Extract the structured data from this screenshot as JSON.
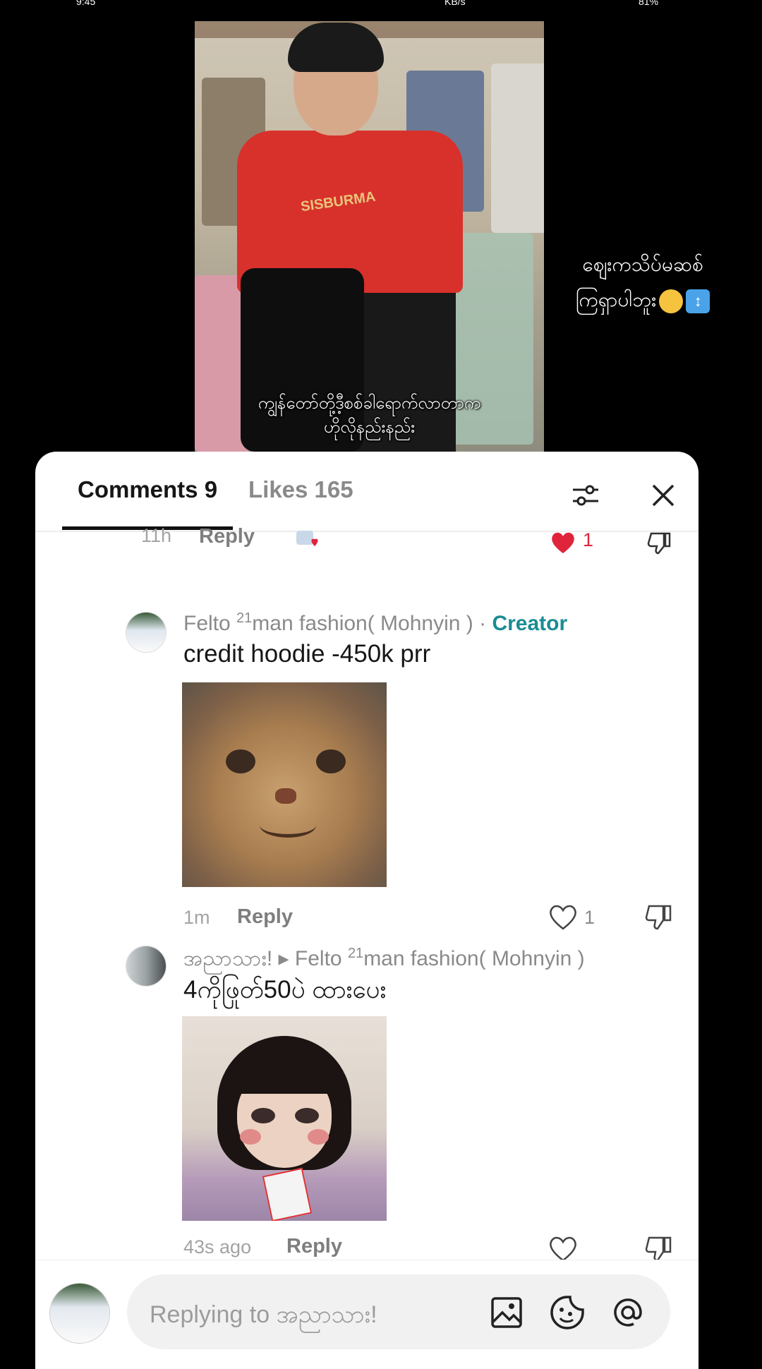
{
  "status": {
    "time": "9:45",
    "speed": "KB/s",
    "battery": "81%"
  },
  "video": {
    "shirt_text": "SISBURMA",
    "caption_line1": "ကျွန်တော်တို့ဒီ့စစ်ခါရောက်လာတာက",
    "caption_line2": "ဟိုလိုနည်းနည်း",
    "side_line1": "ဈေးကသိပ်မဆစ်",
    "side_line2": "ကြရှာပါဘူး"
  },
  "tabs": {
    "comments": "Comments 9",
    "likes": "Likes 165"
  },
  "previous_comment": {
    "time": "11h",
    "reply": "Reply",
    "likes": "1"
  },
  "comments": [
    {
      "author": "Felto",
      "author_sup": "21",
      "author_rest": "man fashion( Mohnyin ) · ",
      "badge": "Creator",
      "text": "credit hoodie -450k prr",
      "time": "1m",
      "reply": "Reply",
      "likes": "1"
    },
    {
      "author": "အညာသား! ▸ Felto ",
      "author_sup": "21",
      "author_rest": "man fashion( Mohnyin )",
      "text": "4ကိုဖြုတ်50ပဲ ထားပေး",
      "time": "43s ago",
      "reply": "Reply"
    }
  ],
  "input": {
    "placeholder": "Replying to အညာသား!"
  },
  "icons": [
    "filter-icon",
    "close-icon",
    "heart-icon",
    "dislike-icon",
    "image-icon",
    "sticker-icon",
    "mention-icon"
  ],
  "colors": {
    "accent": "#1a8c94",
    "like_red": "#e0243c"
  }
}
